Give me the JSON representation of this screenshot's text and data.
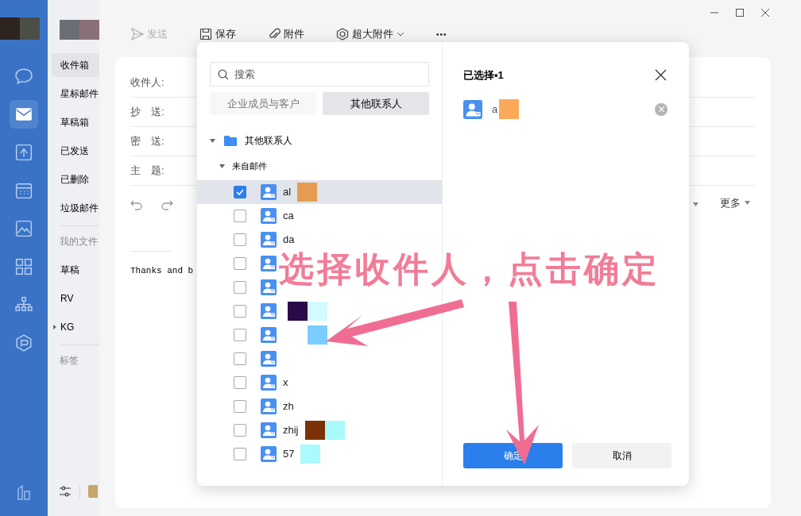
{
  "toolbar": [
    {
      "kind": "send",
      "label": "发送",
      "disabled": true
    },
    {
      "kind": "save",
      "label": "保存",
      "disabled": false
    },
    {
      "kind": "attach",
      "label": "附件",
      "disabled": false
    },
    {
      "kind": "large",
      "label": "超大附件",
      "disabled": false
    },
    {
      "kind": "more",
      "label": "•••",
      "disabled": false
    }
  ],
  "rail": [
    {
      "kind": "chat",
      "selected": false
    },
    {
      "kind": "mail",
      "selected": true
    },
    {
      "kind": "doc",
      "selected": false
    },
    {
      "kind": "calendar",
      "selected": false
    },
    {
      "kind": "image",
      "selected": false
    },
    {
      "kind": "apps",
      "selected": false
    },
    {
      "kind": "org",
      "selected": false
    },
    {
      "kind": "cube",
      "selected": false
    }
  ],
  "folders": [
    {
      "kind": "item",
      "label": "收件箱",
      "selected": true
    },
    {
      "kind": "item",
      "label": "星标邮件",
      "selected": false
    },
    {
      "kind": "item",
      "label": "草稿箱",
      "selected": false
    },
    {
      "kind": "item",
      "label": "已发送",
      "selected": false
    },
    {
      "kind": "item",
      "label": "已删除",
      "selected": false
    },
    {
      "kind": "item",
      "label": "垃圾邮件",
      "selected": false
    },
    {
      "kind": "header",
      "label": "我的文件"
    },
    {
      "kind": "item",
      "label": "草稿",
      "selected": false
    },
    {
      "kind": "item",
      "label": "RV",
      "selected": false
    },
    {
      "kind": "group",
      "label": "KG",
      "selected": false
    },
    {
      "kind": "header",
      "label": "标签"
    }
  ],
  "compose": {
    "fields": [
      "收件人:",
      "抄　送:",
      "密　送:",
      "主　题:"
    ],
    "more": "更多",
    "body": "Thanks and b"
  },
  "dialog": {
    "search": {
      "placeholder": "搜索"
    },
    "tabs": [
      {
        "label": "企业成员与客户",
        "selected": false
      },
      {
        "label": "其他联系人",
        "selected": true
      }
    ],
    "tree": {
      "label": "其他联系人",
      "expanded": true,
      "children": [
        {
          "label": "来自邮件",
          "expanded": true
        }
      ]
    },
    "contacts": [
      {
        "name": "al",
        "checked": true
      },
      {
        "name": "ca",
        "checked": false
      },
      {
        "name": "da",
        "checked": false
      },
      {
        "checked": false
      },
      {
        "checked": false
      },
      {
        "checked": false
      },
      {
        "checked": false
      },
      {
        "checked": false
      },
      {
        "name": "x",
        "checked": false
      },
      {
        "name": "zh",
        "checked": false
      },
      {
        "name": "zhij",
        "checked": false
      },
      {
        "name": "57",
        "checked": false
      }
    ],
    "selected_title": "已选择•1",
    "selected": [
      {
        "name": "a"
      }
    ],
    "ok": "确定",
    "cancel": "取消"
  },
  "annotation": {
    "text": "选择收件人，点击确定"
  }
}
